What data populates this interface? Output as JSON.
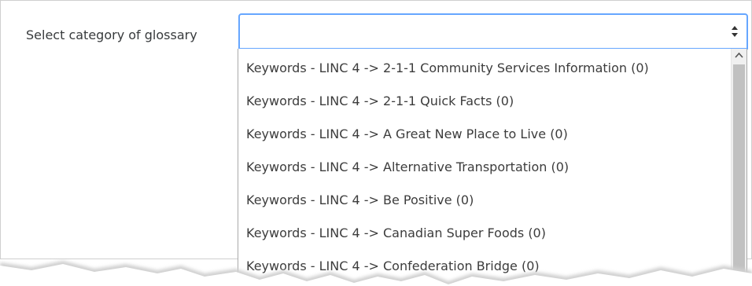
{
  "form": {
    "label": "Select category of glossary",
    "selected_value": "",
    "options": [
      "Keywords - LINC 4 -> 2-1-1 Community Services Information (0)",
      "Keywords - LINC 4 -> 2-1-1 Quick Facts (0)",
      "Keywords - LINC 4 -> A Great New Place to Live (0)",
      "Keywords - LINC 4 -> Alternative Transportation (0)",
      "Keywords - LINC 4 -> Be Positive (0)",
      "Keywords - LINC 4 -> Canadian Super Foods (0)",
      "Keywords - LINC 4 -> Confederation Bridge (0)"
    ]
  },
  "icons": {
    "select_arrow": "up-down-caret-icon",
    "scroll_up": "scroll-up-arrow-icon"
  },
  "colors": {
    "focus_border": "#66a6ff",
    "text": "#373a3c",
    "scroll_thumb": "#c1c1c1"
  }
}
